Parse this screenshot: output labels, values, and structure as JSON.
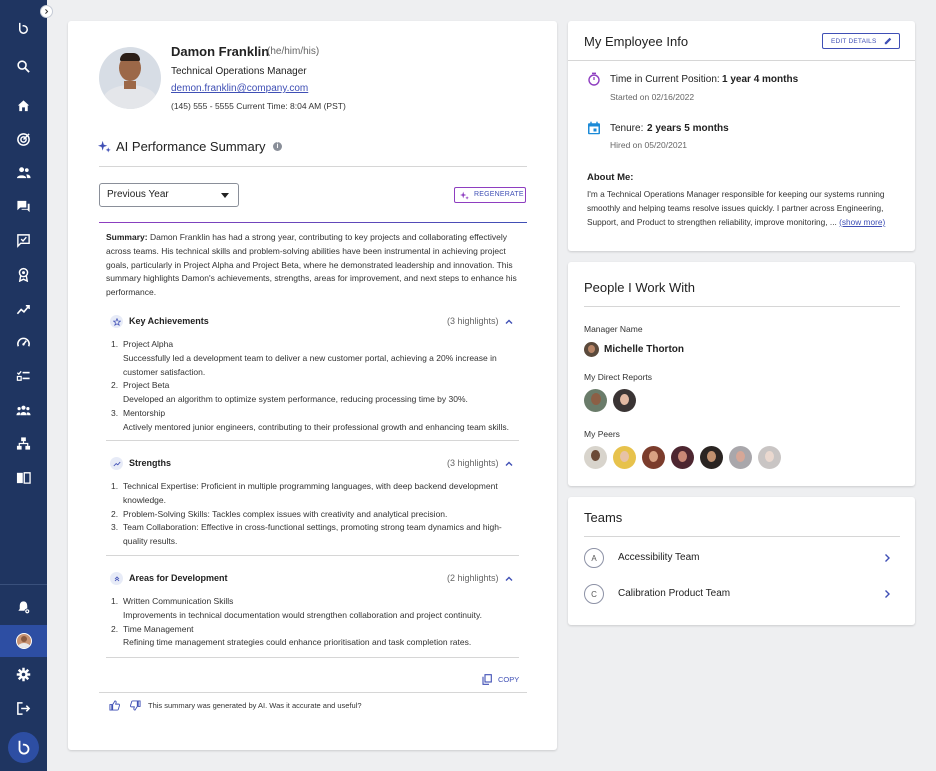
{
  "colors": {
    "sidebar": "#1f3561",
    "accent": "#3f4fb5",
    "link": "#3f4fb5",
    "ai_purple": "#8e3ec0",
    "tenure_blue": "#1b8ad7"
  },
  "sidebar": {
    "items": [
      {
        "icon": "search-icon"
      },
      {
        "icon": "home-icon"
      },
      {
        "icon": "target-icon"
      },
      {
        "icon": "people-icon"
      },
      {
        "icon": "chat-icon"
      },
      {
        "icon": "feedback-icon"
      },
      {
        "icon": "award-icon"
      },
      {
        "icon": "trend-icon"
      },
      {
        "icon": "gauge-icon"
      },
      {
        "icon": "checklist-icon"
      },
      {
        "icon": "group-icon"
      },
      {
        "icon": "org-chart-icon"
      },
      {
        "icon": "book-icon"
      }
    ],
    "bottom": [
      {
        "icon": "notification-settings-icon"
      },
      {
        "icon": "avatar"
      },
      {
        "icon": "gear-icon"
      },
      {
        "icon": "logout-icon"
      }
    ]
  },
  "profile": {
    "name": "Damon Franklin",
    "pronouns": "(he/him/his)",
    "title": "Technical Operations Manager",
    "email": "demon.franklin@company.com",
    "phone_time": "(145) 555 - 5555 Current Time: 8:04 AM (PST)"
  },
  "ai_summary": {
    "heading": "AI Performance Summary",
    "period": "Previous Year",
    "regenerate_label": "REGENERATE",
    "summary_label": "Summary:",
    "summary_text": "Damon Franklin has had a strong year, contributing to key projects and collaborating effectively across teams. His technical skills and problem-solving abilities have been instrumental in achieving project goals, particularly in Project Alpha and Project Beta, where he demonstrated leadership and innovation. This summary highlights Damon's achievements, strengths, areas for improvement, and next steps to enhance his performance.",
    "sections": {
      "achievements": {
        "title": "Key Achievements",
        "count": "(3 highlights)",
        "items": [
          {
            "num": "1.",
            "title": "Project Alpha",
            "desc": "Successfully led a development team to deliver a new customer portal, achieving a 20% increase in customer satisfaction."
          },
          {
            "num": "2.",
            "title": "Project Beta",
            "desc": "Developed an algorithm to optimize system performance, reducing processing time by 30%."
          },
          {
            "num": "3.",
            "title": "Mentorship",
            "desc": "Actively mentored junior engineers, contributing to their professional growth and enhancing team skills."
          }
        ]
      },
      "strengths": {
        "title": "Strengths",
        "count": "(3 highlights)",
        "items": [
          {
            "num": "1.",
            "text": "Technical Expertise: Proficient in multiple programming languages, with deep backend development knowledge."
          },
          {
            "num": "2.",
            "text": "Problem-Solving Skills: Tackles complex issues with creativity and analytical precision."
          },
          {
            "num": "3.",
            "text": "Team Collaboration: Effective in cross-functional settings, promoting strong team dynamics and high-quality results."
          }
        ]
      },
      "development": {
        "title": "Areas for Development",
        "count": "(2 highlights)",
        "items": [
          {
            "num": "1.",
            "title": "Written Communication Skills",
            "desc": "Improvements in technical documentation would strengthen collaboration and project continuity."
          },
          {
            "num": "2.",
            "title": "Time Management",
            "desc": "Refining time management strategies could enhance prioritisation and task completion rates."
          }
        ]
      }
    },
    "copy_label": "COPY",
    "feedback_text": "This summary was generated by AI. Was it accurate and useful?"
  },
  "employee_info": {
    "title": "My Employee Info",
    "edit_label": "EDIT DETAILS",
    "time_label": "Time in Current Position:",
    "time_value": "1 year 4 months",
    "time_sub": "Started on 02/16/2022",
    "tenure_label": "Tenure:",
    "tenure_value": "2 years 5 months",
    "tenure_sub": "Hired on 05/20/2021",
    "about_label": "About Me:",
    "about_text": "I'm a Technical Operations Manager responsible for keeping our systems running smoothly and helping teams resolve issues quickly. I partner across Engineering, Support, and Product to strengthen reliability, improve monitoring, ...",
    "show_more": "(show more)"
  },
  "people": {
    "title": "People I Work With",
    "manager_label": "Manager Name",
    "manager_name": "Michelle Thorton",
    "reports_label": "My Direct Reports",
    "peers_label": "My Peers"
  },
  "teams": {
    "title": "Teams",
    "items": [
      {
        "initial": "A",
        "name": "Accessibility Team"
      },
      {
        "initial": "C",
        "name": "Calibration Product Team"
      }
    ]
  }
}
